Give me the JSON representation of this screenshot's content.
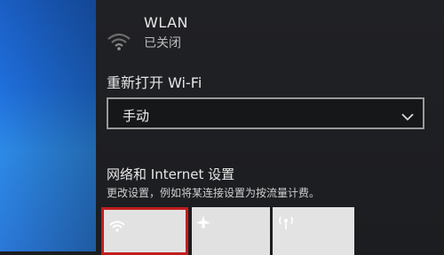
{
  "wlan": {
    "title": "WLAN",
    "status": "已关闭",
    "icon": "wifi-off-icon"
  },
  "reopen": {
    "label": "重新打开 Wi-Fi",
    "selected": "手动",
    "icon": "chevron-down-icon"
  },
  "network_settings": {
    "title": "网络和 Internet 设置",
    "description": "更改设置，例如将某连接设置为按流量计费。"
  },
  "quick_actions": [
    {
      "icon": "wifi-icon",
      "highlighted": true
    },
    {
      "icon": "airplane-icon",
      "highlighted": false
    },
    {
      "icon": "mobile-hotspot-icon",
      "highlighted": false
    }
  ],
  "colors": {
    "highlight": "#c21e1e",
    "panel": "#1c1d20",
    "desktop": "#1f6fdc"
  }
}
